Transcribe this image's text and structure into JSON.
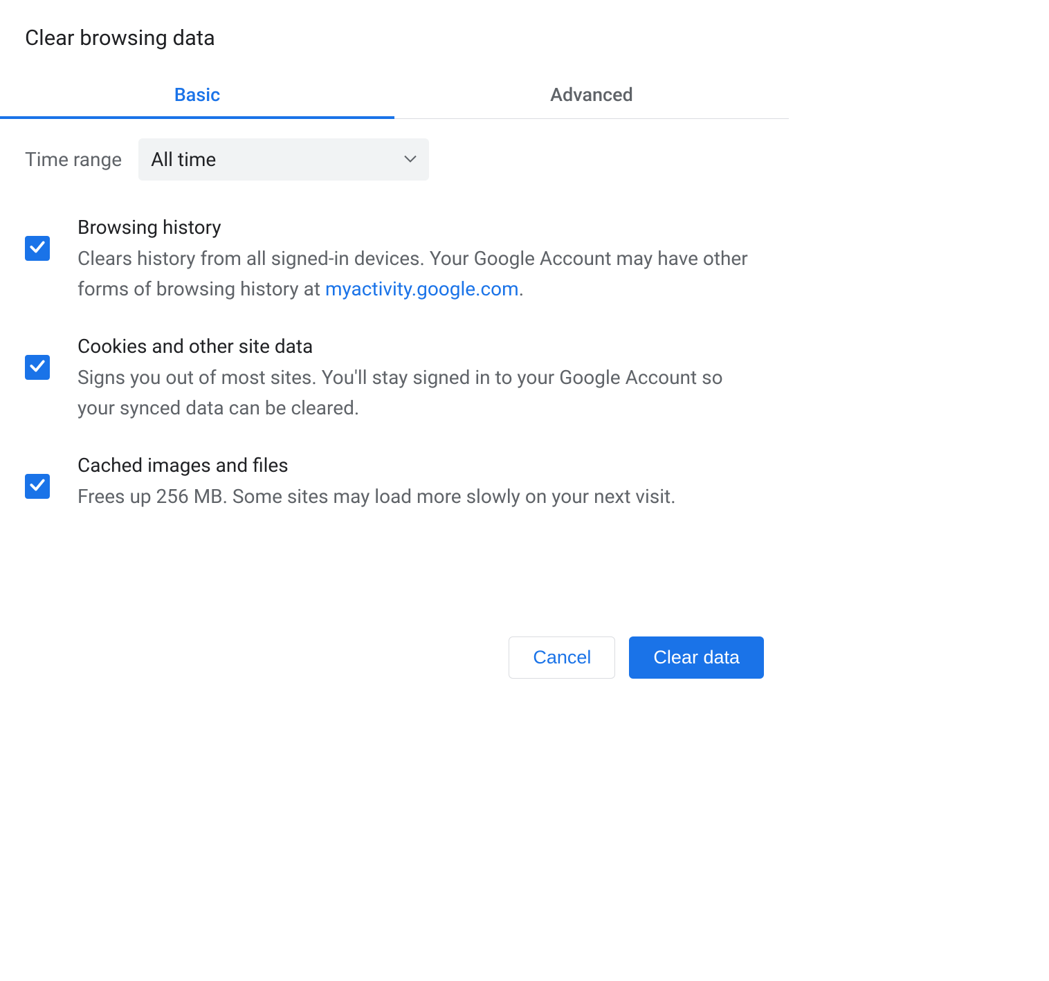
{
  "dialog": {
    "title": "Clear browsing data"
  },
  "tabs": {
    "basic": "Basic",
    "advanced": "Advanced",
    "active": "basic"
  },
  "time_range": {
    "label": "Time range",
    "selected": "All time"
  },
  "options": [
    {
      "title": "Browsing history",
      "desc_pre": "Clears history from all signed-in devices. Your Google Account may have other forms of browsing history at ",
      "link_text": "myactivity.google.com",
      "desc_post": ".",
      "checked": true
    },
    {
      "title": "Cookies and other site data",
      "desc": "Signs you out of most sites. You'll stay signed in to your Google Account so your synced data can be cleared.",
      "checked": true
    },
    {
      "title": "Cached images and files",
      "desc": "Frees up 256 MB. Some sites may load more slowly on your next visit.",
      "checked": true
    }
  ],
  "buttons": {
    "cancel": "Cancel",
    "clear": "Clear data"
  },
  "colors": {
    "primary": "#1a73e8",
    "text": "#202124",
    "text_secondary": "#5f6368",
    "border": "#dadce0",
    "select_bg": "#f1f3f4"
  }
}
